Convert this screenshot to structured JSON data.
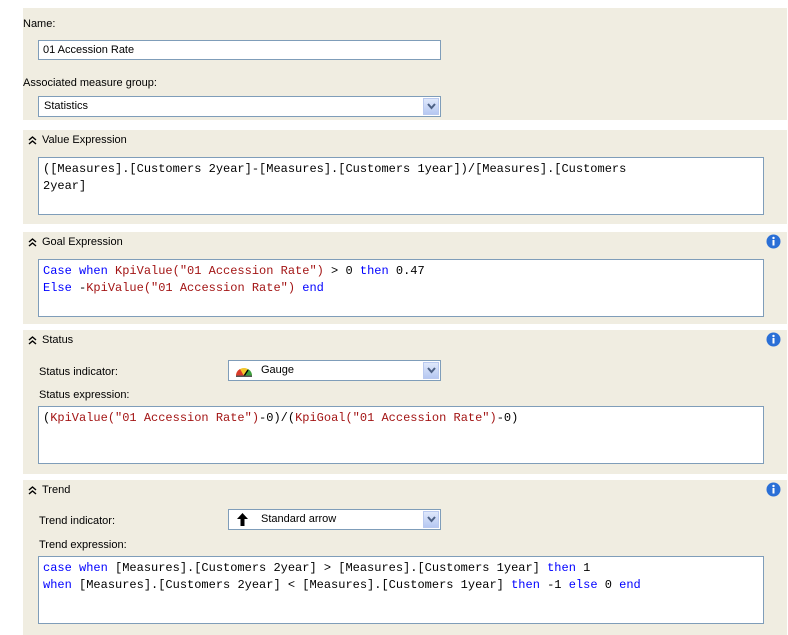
{
  "name_label": "Name:",
  "name_value": "01 Accession Rate",
  "measure_group_label": "Associated measure group:",
  "measure_group_value": "Statistics",
  "value_section": {
    "title": "Value Expression",
    "line1": "([Measures].[Customers 2year]-[Measures].[Customers 1year])/[Measures].[Customers",
    "line2": "2year]"
  },
  "goal_section": {
    "title": "Goal Expression",
    "line1": {
      "a": "Case when ",
      "b": "KpiValue(\"01 Accession Rate\")",
      "c": " > 0 ",
      "d": "then",
      "e": " 0.47"
    },
    "line2": {
      "a": "Else",
      "b": " -",
      "c": "KpiValue(\"01 Accession Rate\")",
      "d": " ",
      "e": "end"
    }
  },
  "status_section": {
    "title": "Status",
    "indicator_label": "Status indicator:",
    "indicator_value": "Gauge",
    "expression_label": "Status expression:",
    "line1": {
      "a": "(",
      "b": "KpiValue(\"01 Accession Rate\")",
      "c": "-0)/(",
      "d": "KpiGoal(\"01 Accession Rate\")",
      "e": "-0)"
    }
  },
  "trend_section": {
    "title": "Trend",
    "indicator_label": "Trend indicator:",
    "indicator_value": "Standard arrow",
    "expression_label": "Trend expression:",
    "line1": {
      "a": "case when",
      "b": " [Measures].[Customers 2year] > [Measures].[Customers 1year] ",
      "c": "then",
      "d": " 1"
    },
    "line2": {
      "a": "when",
      "b": " [Measures].[Customers 2year] < [Measures].[Customers 1year] ",
      "c": "then",
      "d": " -1 ",
      "e": "else",
      "f": " 0 ",
      "g": "end"
    }
  },
  "icons": {
    "collapse": "double-chevron-up-icon",
    "info": "info-icon",
    "dropdown": "chevron-down-icon",
    "gauge": "gauge-icon",
    "arrow": "arrow-up-icon"
  },
  "colors": {
    "panel": "#f0ede1",
    "border": "#7f9db9",
    "keyword": "#0000ff",
    "string": "#a31515",
    "info": "#2a6fd6"
  }
}
